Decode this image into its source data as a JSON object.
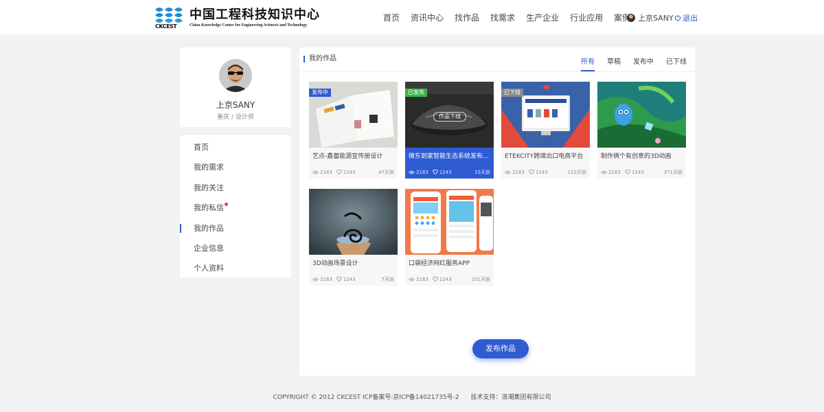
{
  "brand": {
    "mark_text": "CKCEST",
    "name_cn": "中国工程科技知识中心",
    "name_en": "China Knowledge Centre for Engineering Sciences and Technology",
    "color": "#1a8fd8"
  },
  "nav": [
    "首页",
    "资讯中心",
    "找作品",
    "找需求",
    "生产企业",
    "行业应用",
    "案例"
  ],
  "user": {
    "name": "上京SANY",
    "logout": "退出"
  },
  "profile": {
    "name": "上京SANY",
    "meta": "重庆 / 设计师"
  },
  "side_menu": [
    {
      "label": "首页"
    },
    {
      "label": "我的需求"
    },
    {
      "label": "我的关注"
    },
    {
      "label": "我的私信",
      "unread": true
    },
    {
      "label": "我的作品",
      "active": true
    },
    {
      "label": "企业信息"
    },
    {
      "label": "个人资料"
    }
  ],
  "main": {
    "title": "我的作品",
    "tabs": [
      {
        "label": "所有",
        "active": true
      },
      {
        "label": "草稿"
      },
      {
        "label": "发布中"
      },
      {
        "label": "已下线"
      }
    ],
    "publish_label": "发布作品"
  },
  "works": [
    {
      "title": "艺点-鑫蕾能源宣传册设计",
      "views": "2183",
      "likes": "1243",
      "ago": "47天前",
      "badge": "发布中",
      "badge_color": "#2f5bd3"
    },
    {
      "title": "微东到家智能生态系统发布会设计",
      "views": "2183",
      "likes": "1243",
      "ago": "15天前",
      "badge": "已发布",
      "badge_color": "#3bb54a",
      "overlay": "作品下线",
      "selected": true
    },
    {
      "title": "ETEKCITY跨境出口电商平台",
      "views": "2183",
      "likes": "1243",
      "ago": "122天前",
      "badge": "已下线",
      "badge_color": "#888888"
    },
    {
      "title": "制作俩个有创意的3D动画",
      "views": "2183",
      "likes": "1243",
      "ago": "371天前"
    },
    {
      "title": "3D动画场景设计",
      "views": "2183",
      "likes": "1243",
      "ago": "7天前"
    },
    {
      "title": "口袋经济网红服务APP",
      "views": "2183",
      "likes": "1243",
      "ago": "331天前"
    }
  ],
  "footer": {
    "copyright": "COPYRIGHT © 2012 CKCEST ICP备案号:京ICP备14021735号-2",
    "support": "技术支持：浪潮集团有限公司"
  },
  "colors": {
    "accent": "#2f5bd3",
    "badge_red": "#f23b3b"
  }
}
